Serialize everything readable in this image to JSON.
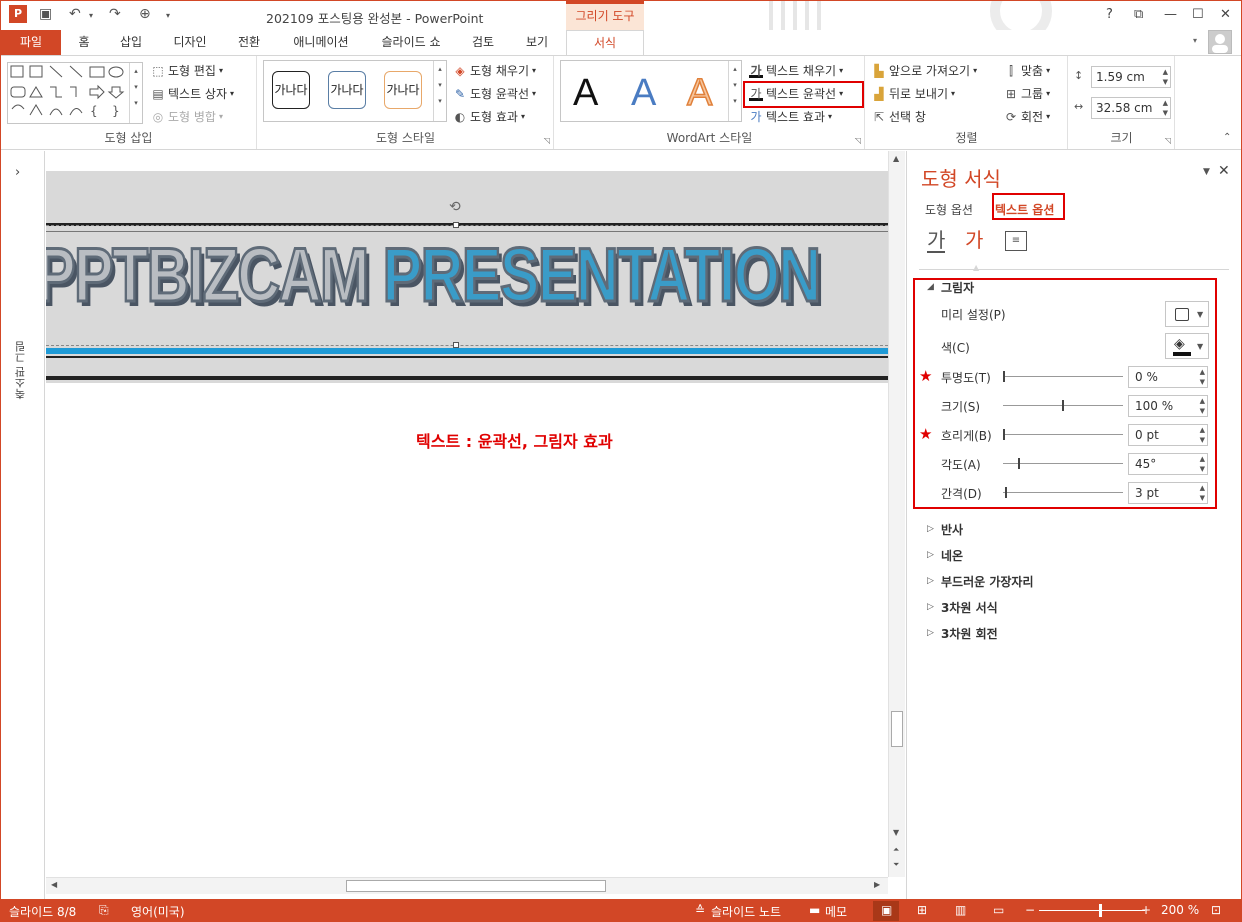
{
  "app": {
    "title": "202109 포스팅용 완성본 - PowerPoint",
    "context_tab_group": "그리기 도구",
    "window_buttons": [
      "?",
      "⧉",
      "—",
      "☐",
      "✕"
    ]
  },
  "tabs": [
    {
      "label": "파일"
    },
    {
      "label": "홈"
    },
    {
      "label": "삽입"
    },
    {
      "label": "디자인"
    },
    {
      "label": "전환"
    },
    {
      "label": "애니메이션"
    },
    {
      "label": "슬라이드 쇼"
    },
    {
      "label": "검토"
    },
    {
      "label": "보기"
    },
    {
      "label": "서식"
    }
  ],
  "ribbon": {
    "shape_insert": {
      "label": "도형 삽입",
      "edit_shape": "도형 편집",
      "text_box": "텍스트 상자",
      "merge_shapes": "도형 병합"
    },
    "shape_styles": {
      "label": "도형 스타일",
      "samples": [
        "가나다",
        "가나다",
        "가나다"
      ],
      "fill": "도형 채우기",
      "outline": "도형 윤곽선",
      "effects": "도형 효과"
    },
    "wordart": {
      "label": "WordArt 스타일",
      "sample_letter": "A",
      "text_fill": "텍스트 채우기",
      "text_outline": "텍스트 윤곽선",
      "text_effects": "텍스트 효과",
      "icon_glyph": "가"
    },
    "arrange": {
      "label": "정렬",
      "bring_forward": "앞으로 가져오기",
      "send_backward": "뒤로 보내기",
      "selection_pane": "선택 창",
      "align": "맞춤",
      "group": "그룹",
      "rotate": "회전"
    },
    "size": {
      "label": "크기",
      "height": "1.59 cm",
      "width": "32.58 cm"
    }
  },
  "thumbnail_pane": {
    "label": "축소판 그림"
  },
  "slide": {
    "banner_word1": "PPTBIZCAM ",
    "banner_word2": "PRESENTATION",
    "annotation": "텍스트 : 윤곽선, 그림자 효과"
  },
  "format_pane": {
    "title": "도형 서식",
    "tab_shape": "도형 옵션",
    "tab_text": "텍스트 옵션",
    "icon_glyph": "가",
    "shadow": {
      "header": "그림자",
      "preset": "미리 설정(P)",
      "color": "색(C)",
      "transparency": {
        "label": "투명도(T)",
        "value": "0 %",
        "level": 0
      },
      "size": {
        "label": "크기(S)",
        "value": "100 %",
        "level": 0.5
      },
      "blur": {
        "label": "흐리게(B)",
        "value": "0 pt",
        "level": 0
      },
      "angle": {
        "label": "각도(A)",
        "value": "45°",
        "level": 0.125
      },
      "distance": {
        "label": "간격(D)",
        "value": "3 pt",
        "level": 0.015
      }
    },
    "sections": [
      "반사",
      "네온",
      "부드러운 가장자리",
      "3차원 서식",
      "3차원 회전"
    ]
  },
  "statusbar": {
    "slide_info": "슬라이드 8/8",
    "language": "영어(미국)",
    "notes": "슬라이드 노트",
    "comments": "메모",
    "zoom": "200 %"
  },
  "colors": {
    "accent": "#d24726",
    "highlight": "#e00000",
    "banner_blue": "#3a9cc8",
    "banner_gray": "#b9bdc2"
  }
}
